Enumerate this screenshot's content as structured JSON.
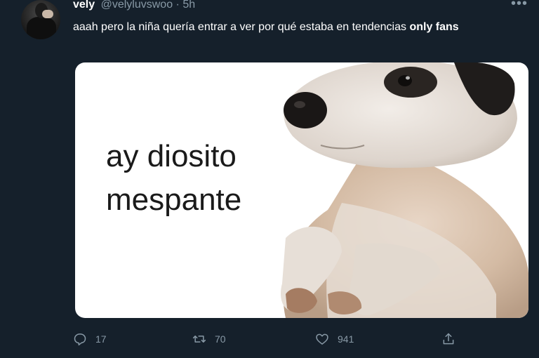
{
  "tweet": {
    "name": "vely",
    "handle": "@velyluvswoo",
    "time": "· 5h",
    "text": "aaah pero la niña quería entrar a ver por qué estaba en tendencias ",
    "text_bold": "only fans"
  },
  "media": {
    "caption_line1": "ay diosito",
    "caption_line2": "mespante"
  },
  "actions": {
    "reply_count": "17",
    "retweet_count": "70",
    "like_count": "941"
  },
  "icons": [
    "more-icon",
    "reply-icon",
    "retweet-icon",
    "like-icon",
    "share-icon"
  ],
  "colors": {
    "background": "#15202b",
    "muted": "#8899a6",
    "text": "#ffffff"
  }
}
